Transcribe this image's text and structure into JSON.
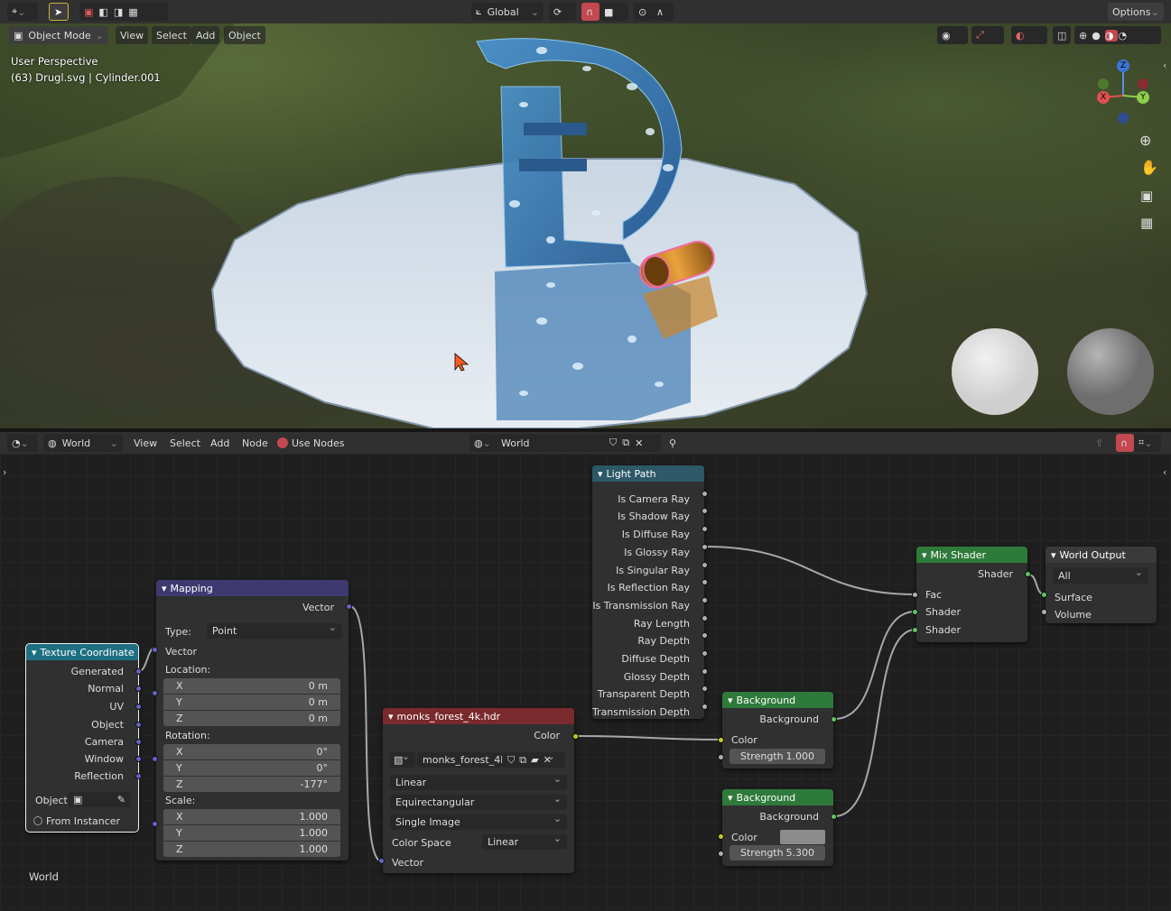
{
  "top_header": {
    "global_label": "Global",
    "options_label": "Options"
  },
  "viewport_header": {
    "mode": "Object Mode",
    "menus": [
      "View",
      "Select",
      "Add",
      "Object"
    ]
  },
  "viewport": {
    "perspective": "User Perspective",
    "object_info": "(63) Drugl.svg | Cylinder.001",
    "gizmo": {
      "z": "Z",
      "y": "Y",
      "x": "X"
    }
  },
  "node_header": {
    "editor_type": "World",
    "menus": [
      "View",
      "Select",
      "Add",
      "Node"
    ],
    "use_nodes": "Use Nodes",
    "world_name": "World"
  },
  "nodes": {
    "texcoord": {
      "title": "Texture Coordinate",
      "outputs": [
        "Generated",
        "Normal",
        "UV",
        "Object",
        "Camera",
        "Window",
        "Reflection"
      ],
      "object_label": "Object:",
      "from_instancer": "From Instancer"
    },
    "mapping": {
      "title": "Mapping",
      "out": "Vector",
      "type_label": "Type:",
      "type_value": "Point",
      "in_vector": "Vector",
      "location_label": "Location:",
      "location": [
        {
          "a": "X",
          "v": "0 m"
        },
        {
          "a": "Y",
          "v": "0 m"
        },
        {
          "a": "Z",
          "v": "0 m"
        }
      ],
      "rotation_label": "Rotation:",
      "rotation": [
        {
          "a": "X",
          "v": "0°"
        },
        {
          "a": "Y",
          "v": "0°"
        },
        {
          "a": "Z",
          "v": "-177°"
        }
      ],
      "scale_label": "Scale:",
      "scale": [
        {
          "a": "X",
          "v": "1.000"
        },
        {
          "a": "Y",
          "v": "1.000"
        },
        {
          "a": "Z",
          "v": "1.000"
        }
      ]
    },
    "envtex": {
      "title": "monks_forest_4k.hdr",
      "out": "Color",
      "image": "monks_forest_4k...",
      "interp": "Linear",
      "projection": "Equirectangular",
      "source": "Single Image",
      "cs_label": "Color Space",
      "cs_value": "Linear",
      "in_vector": "Vector"
    },
    "lightpath": {
      "title": "Light Path",
      "outputs": [
        "Is Camera Ray",
        "Is Shadow Ray",
        "Is Diffuse Ray",
        "Is Glossy Ray",
        "Is Singular Ray",
        "Is Reflection Ray",
        "Is Transmission Ray",
        "Ray Length",
        "Ray Depth",
        "Diffuse Depth",
        "Glossy Depth",
        "Transparent Depth",
        "Transmission Depth"
      ]
    },
    "bg1": {
      "title": "Background",
      "out": "Background",
      "color": "Color",
      "strength_label": "Strength",
      "strength": "1.000"
    },
    "bg2": {
      "title": "Background",
      "out": "Background",
      "color": "Color",
      "strength_label": "Strength",
      "strength": "5.300"
    },
    "mix": {
      "title": "Mix Shader",
      "out": "Shader",
      "fac": "Fac",
      "shader1": "Shader",
      "shader2": "Shader"
    },
    "worldout": {
      "title": "World Output",
      "target": "All",
      "surface": "Surface",
      "volume": "Volume"
    }
  },
  "frame_label": "World"
}
